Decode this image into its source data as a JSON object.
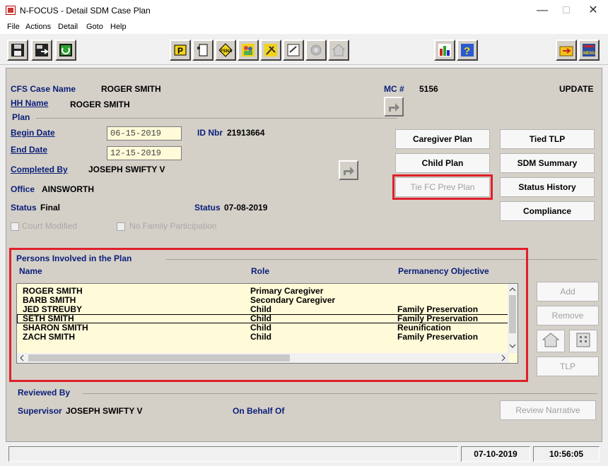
{
  "window": {
    "title": "N-FOCUS - Detail SDM Case Plan",
    "controls": {
      "minimize": "—",
      "maximize": "□",
      "close": "✕"
    }
  },
  "menu": [
    "File",
    "Actions",
    "Detail",
    "Goto",
    "Help"
  ],
  "toolbar": {
    "left_icons": [
      "save-icon",
      "save-exit-icon",
      "refresh-icon"
    ],
    "center_icons": [
      "p-icon",
      "document-icon",
      "fsna-icon",
      "people-icon",
      "tools-icon",
      "notes-icon",
      "camera-icon",
      "house-icon"
    ],
    "right_icons": [
      "chart-icon",
      "help-icon"
    ],
    "far_right_icons": [
      "folder-icon",
      "menu-icon"
    ],
    "menu_icon_label": "MENU",
    "fsna_label": "FSNA",
    "p_label": "P"
  },
  "case": {
    "cfs_label": "CFS Case Name",
    "cfs_value": "ROGER SMITH",
    "hh_label": "HH Name",
    "hh_value": "ROGER SMITH",
    "mc_label": "MC #",
    "mc_value": "5156",
    "mode": "UPDATE"
  },
  "plan": {
    "group_label": "Plan",
    "begin_label": "Begin Date",
    "begin_value": "06-15-2019",
    "end_label": "End Date",
    "end_value": "12-15-2019",
    "id_label": "ID Nbr",
    "id_value": "21913664",
    "completed_label": "Completed By",
    "completed_value": "JOSEPH SWIFTY V",
    "office_label": "Office",
    "office_value": "AINSWORTH",
    "status_label": "Status",
    "status_value": "Final",
    "status_date_label": "Status",
    "status_date_value": "07-08-2019",
    "court_modified": "Court Modified",
    "no_family": "No Family Participation"
  },
  "buttons": {
    "caregiver_plan": "Caregiver Plan",
    "tied_tlp": "Tied TLP",
    "child_plan": "Child Plan",
    "sdm_summary": "SDM Summary",
    "tie_fc": "Tie FC Prev Plan",
    "status_history": "Status History",
    "compliance": "Compliance",
    "add": "Add",
    "remove": "Remove",
    "tlp": "TLP",
    "review_narrative": "Review Narrative"
  },
  "persons": {
    "group_label": "Persons Involved in the Plan",
    "columns": [
      "Name",
      "Role",
      "Permanency Objective"
    ],
    "rows": [
      {
        "name": "ROGER SMITH",
        "role": "Primary Caregiver",
        "objective": ""
      },
      {
        "name": "BARB SMITH",
        "role": "Secondary Caregiver",
        "objective": ""
      },
      {
        "name": "JED STREUBY",
        "role": "Child",
        "objective": "Family Preservation"
      },
      {
        "name": "SETH SMITH",
        "role": "Child",
        "objective": "Family Preservation"
      },
      {
        "name": "SHARON SMITH",
        "role": "Child",
        "objective": "Reunification"
      },
      {
        "name": "ZACH SMITH",
        "role": "Child",
        "objective": "Family Preservation"
      }
    ]
  },
  "reviewed": {
    "group_label": "Reviewed By",
    "supervisor_label": "Supervisor",
    "supervisor_value": "JOSEPH SWIFTY V",
    "on_behalf_label": "On Behalf Of"
  },
  "status_bar": {
    "date": "07-10-2019",
    "time": "10:56:05"
  },
  "colors": {
    "label_blue": "#0a1e78",
    "highlight_red": "#e0202a",
    "field_yellow": "#fffbd9"
  }
}
